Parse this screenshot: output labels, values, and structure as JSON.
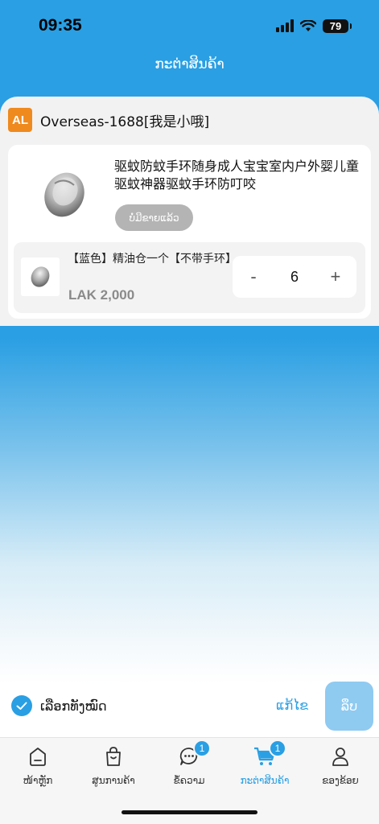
{
  "status_bar": {
    "time": "09:35",
    "battery": "79"
  },
  "header": {
    "title": "ກະຕ່າສິນຄ້າ"
  },
  "shop": {
    "badge": "AL",
    "name": "Overseas-1688[我是小哦]"
  },
  "product": {
    "title": "驱蚊防蚊手环随身成人宝宝室内户外婴儿童驱蚊神器驱蚊手环防叮咬",
    "soldout_label": "ບໍ່ມີຂາຍແລ້ວ",
    "image_icon": "mosquito-bracelet-image",
    "variant": {
      "name": "【蓝色】精油仓一个【不带手环】",
      "price": "LAK 2,000",
      "quantity": "6",
      "minus": "-",
      "plus": "+"
    }
  },
  "footer": {
    "select_all_label": "ເລືອກທັງໝົດ",
    "select_all_checked": true,
    "edit_label": "ແກ້ໄຂ",
    "checkout_label": "ລຶບ"
  },
  "tabs": [
    {
      "label": "ໜ້າຫຼັກ",
      "icon": "home-icon",
      "badge": "",
      "active": false
    },
    {
      "label": "ສູນການຄ້າ",
      "icon": "shopping-bag-icon",
      "badge": "",
      "active": false
    },
    {
      "label": "ຂໍ້ຄວາມ",
      "icon": "chat-icon",
      "badge": "1",
      "active": false
    },
    {
      "label": "ກະຕ່າສິນຄ້າ",
      "icon": "cart-icon",
      "badge": "1",
      "active": true
    },
    {
      "label": "ຂອງຂ້ອຍ",
      "icon": "user-icon",
      "badge": "",
      "active": false
    }
  ],
  "colors": {
    "primary": "#2a9fe3",
    "shop_badge": "#ef8a1f",
    "soldout": "#b4b4b4"
  }
}
